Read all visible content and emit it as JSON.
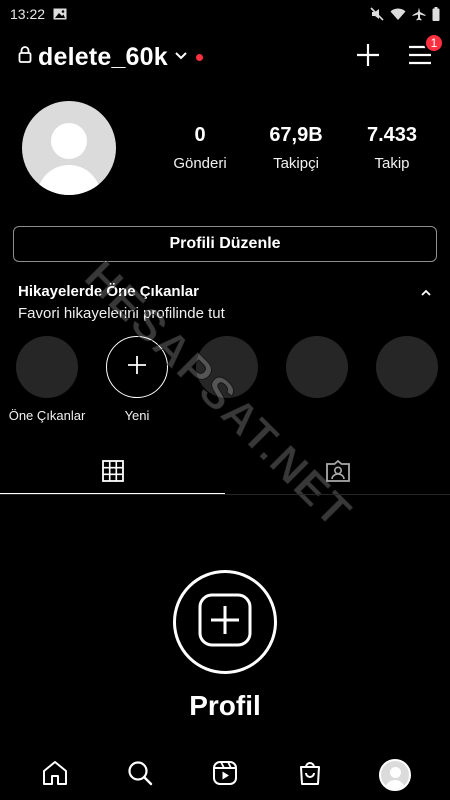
{
  "status_bar": {
    "time": "13:22",
    "icons": [
      "image-icon",
      "mute-icon",
      "wifi-icon",
      "airplane-icon",
      "battery-icon"
    ]
  },
  "header": {
    "username": "delete_60k",
    "notification_count": "1",
    "icons": [
      "lock-icon",
      "chevron-down-icon",
      "plus-icon",
      "menu-icon"
    ]
  },
  "profile": {
    "stats": [
      {
        "value": "0",
        "label": "Gönderi"
      },
      {
        "value": "67,9B",
        "label": "Takipçi"
      },
      {
        "value": "7.433",
        "label": "Takip"
      }
    ],
    "edit_label": "Profili Düzenle"
  },
  "highlights": {
    "title": "Hikayelerde Öne Çıkanlar",
    "subtitle": "Favori hikayelerini profilinde tut",
    "items": [
      {
        "label": "Öne Çıkanlar"
      },
      {
        "label": "Yeni"
      }
    ]
  },
  "tabs": [
    "grid-icon",
    "tagged-icon"
  ],
  "empty_state": {
    "title": "Profil"
  },
  "watermark": "HESAPSAT.NET",
  "bottom_nav": [
    "home-icon",
    "search-icon",
    "reels-icon",
    "shop-icon",
    "profile-avatar"
  ],
  "colors": {
    "background": "#000000",
    "accent_red": "#ff3040",
    "highlight_circle": "#262626"
  }
}
